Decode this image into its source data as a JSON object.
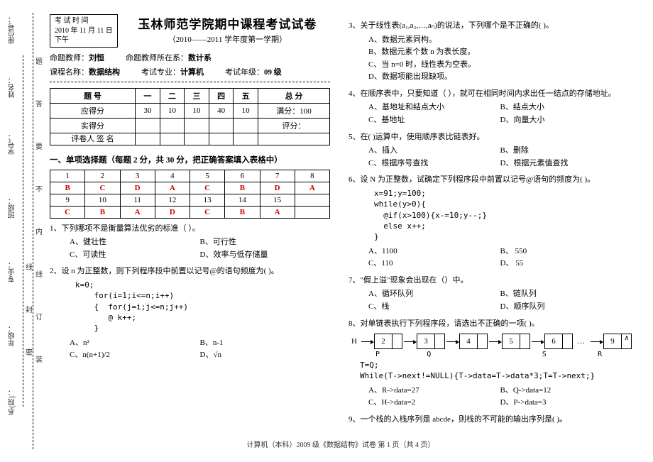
{
  "side": {
    "dept": "系(院)：",
    "grade": "年级：",
    "major": "专业：",
    "class": "班级：",
    "sno": "学号：",
    "name": "姓名：",
    "seat": "座位号：",
    "marks": [
      "装",
      "订",
      "线",
      "内",
      "不",
      "要",
      "答",
      "题"
    ],
    "marks2": [
      "密",
      "封",
      "线"
    ]
  },
  "exam_time": {
    "label": "考 试 时 间",
    "date": "2010 年 11 月 11 日",
    "period": "下午"
  },
  "title": "玉林师范学院期中课程考试试卷",
  "subtitle": "（2010——2011 学年度第一学期）",
  "meta": {
    "teacher_label": "命题教师：",
    "teacher": "刘恒",
    "dept_label": "命题教师所在系：",
    "dept": "数计系",
    "course_label": "课程名称：",
    "course": "数据结构",
    "major_label": "考试专业：",
    "major": "计算机",
    "grade_label": "考试年级：",
    "grade": "09 级"
  },
  "score_table": {
    "rows": [
      "题 号",
      "应得分",
      "实得分",
      "评卷人 签 名"
    ],
    "cols": [
      "一",
      "二",
      "三",
      "四",
      "五",
      "总 分"
    ],
    "fullmarks": [
      "30",
      "10",
      "10",
      "40",
      "10",
      "满分：100"
    ],
    "avg_label": "评分："
  },
  "section1": "一、单项选择题（每题 2 分，共 30 分，把正确答案填入表格中）",
  "answers": {
    "r1": [
      "1",
      "2",
      "3",
      "4",
      "5",
      "6",
      "7",
      "8"
    ],
    "r1k": [
      "B",
      "C",
      "D",
      "A",
      "C",
      "B",
      "D",
      "A"
    ],
    "r2": [
      "9",
      "10",
      "11",
      "12",
      "13",
      "14",
      "15",
      ""
    ],
    "r2k": [
      "C",
      "B",
      "A",
      "D",
      "C",
      "B",
      "A",
      ""
    ]
  },
  "q1": "1、下列哪项不是衡量算法优劣的标准（ ）。",
  "q1o": {
    "a": "A、健壮性",
    "b": "B、可行性",
    "c": "C、可读性",
    "d": "D、效率与低存储量"
  },
  "q2": "2、设 n 为正整数，则下列程序段中前置以记号@的语句频度为( )。",
  "q2code": "k=0;\n    for(i=1;i<=n;i++)\n    {  for(j=i;j<=n;j++)\n       @ k++;\n    }",
  "q2o": {
    "a": "A、n²",
    "b": "B、n-1",
    "c": "C、n(n+1)/2",
    "d": "D、√n"
  },
  "q3": "3、关于线性表(a₁,a₂,…,aₙ)的说法，下列哪个是不正确的( )。",
  "q3o": {
    "a": "A、数据元素同构。",
    "b": "B、数据元素个数 n 为表长度。",
    "c": "C、当 n=0 时，线性表为空表。",
    "d": "D、数据项能出现缺项。"
  },
  "q4": "4、在顺序表中，只要知道（ ），就可在相同时间内求出任一结点的存储地址。",
  "q4o": {
    "a": "A、基地址和结点大小",
    "b": "B、结点大小",
    "c": "C、基地址",
    "d": "D、向量大小"
  },
  "q5": "5、在( )运算中，使用顺序表比链表好。",
  "q5o": {
    "a": "A、插入",
    "b": "B、删除",
    "c": "C、根据序号查找",
    "d": "D、根据元素值查找"
  },
  "q6": "6、设 N 为正整数，试确定下列程序段中前置以记号@语句的频度为( )。",
  "q6code": "x=91;y=100;\nwhile(y>0){\n  @if(x>100){x-=10;y--;}\n  else x++;\n}",
  "q6o": {
    "a": "A、1100",
    "b": "B、 550",
    "c": "C、110",
    "d": "D、 55"
  },
  "q7": "7、\"假上溢\"现象会出现在（）中。",
  "q7o": {
    "a": "A、循环队列",
    "b": "B、链队列",
    "c": "C、栈",
    "d": "D、顺序队列"
  },
  "q8": "8、对单链表执行下列程序段，请选出不正确的一项( )。",
  "ll_nodes": [
    "H",
    "2",
    "3",
    "4",
    "5",
    "6",
    "…",
    "9",
    "∧"
  ],
  "ll_ptrs": "P           Q                          S            R",
  "q8code": "T=Q;\nWhile(T->next!=NULL){T->data=T->data*3;T=T->next;}",
  "q8o": {
    "a": "A、R->data=27",
    "b": "B、Q->data=12",
    "c": "C、H->data=2",
    "d": "D、P->data=3"
  },
  "q9": "9、一个栈的入栈序列是 abcde，则栈的不可能的输出序列是( )。",
  "footer": "计算机（本科）2009 级《数据结构》试卷    第 1 页（共 4 页）"
}
